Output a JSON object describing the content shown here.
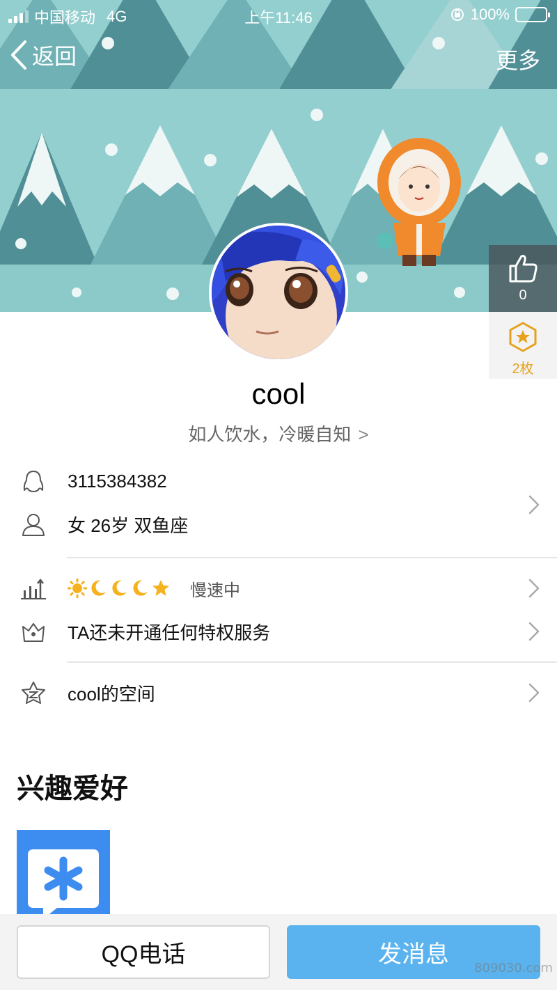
{
  "status_bar": {
    "carrier": "中国移动",
    "network": "4G",
    "time": "上午11:46",
    "battery": "100%",
    "battery_level": 1.0
  },
  "nav": {
    "back_label": "返回",
    "more_label": "更多"
  },
  "likes": {
    "count": "0",
    "icon": "thumbs-up-icon"
  },
  "badges": {
    "count_label": "2枚",
    "icon": "star-hexagon-icon"
  },
  "profile": {
    "nickname": "cool",
    "signature": "如人饮水，冷暖自知"
  },
  "info": {
    "qq_number": "3115384382",
    "personal": "女 26岁 双鱼座",
    "level_status": "慢速中",
    "level_icons": [
      "sun",
      "moon",
      "moon",
      "moon",
      "star"
    ],
    "privilege": "TA还未开通任何特权服务",
    "space": "cool的空间"
  },
  "hobbies": {
    "title": "兴趣爱好"
  },
  "actions": {
    "call_label": "QQ电话",
    "message_label": "发消息"
  },
  "watermark": "809030.com",
  "colors": {
    "banner": "#94cfd0",
    "accent_blue": "#5ab3ee",
    "badge_gold": "#e6a21e"
  }
}
